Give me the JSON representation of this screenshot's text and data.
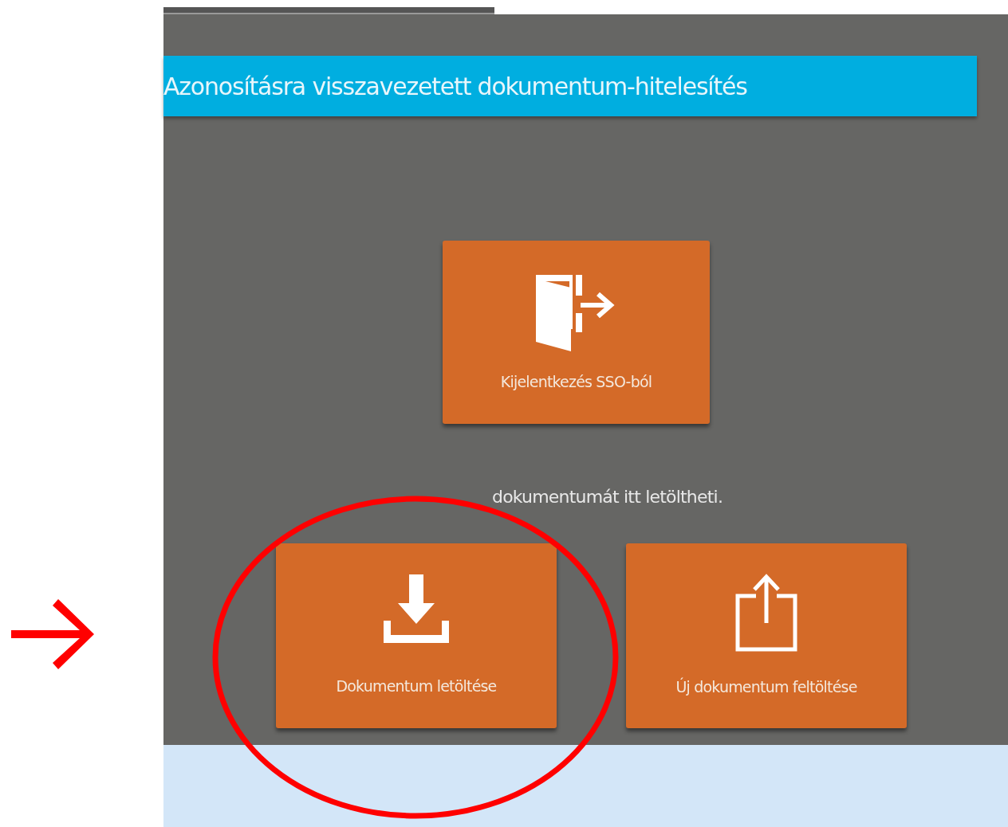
{
  "header": {
    "title": "Azonosításra visszavezetett dokumentum-hitelesítés"
  },
  "logout_button": {
    "kind": "logout",
    "label": "Kijelentkezés SSO-ból"
  },
  "message": "dokumentumát itt letöltheti.",
  "actions": [
    {
      "kind": "download",
      "label": "Dokumentum letöltése"
    },
    {
      "kind": "upload",
      "label": "Új dokumentum feltöltése"
    }
  ],
  "annotations": {
    "highlight_circle": true,
    "pointer_arrow": true
  }
}
